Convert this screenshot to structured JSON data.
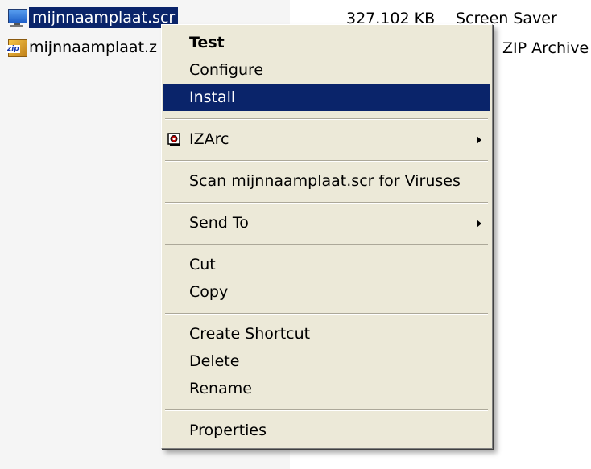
{
  "files": [
    {
      "name": "mijnnaamplaat.scr",
      "size": "327.102 KB",
      "type": "Screen Saver",
      "icon": "monitor-icon",
      "selected": true
    },
    {
      "name": "mijnnaamplaat.z",
      "type": "ZIP Archive",
      "icon": "zip-icon",
      "selected": false
    }
  ],
  "menu": {
    "items": [
      {
        "label": "Test",
        "bold": true
      },
      {
        "label": "Configure"
      },
      {
        "label": "Install",
        "highlighted": true
      },
      {
        "label": "IZArc",
        "icon": "izarc-icon",
        "submenu": true
      },
      {
        "label": "Scan mijnnaamplaat.scr for Viruses"
      },
      {
        "label": "Send To",
        "submenu": true
      },
      {
        "label": "Cut"
      },
      {
        "label": "Copy"
      },
      {
        "label": "Create Shortcut"
      },
      {
        "label": "Delete"
      },
      {
        "label": "Rename"
      },
      {
        "label": "Properties"
      }
    ]
  },
  "colors": {
    "selection": "#0a246a",
    "menu_bg": "#ece9d8",
    "icon_red": "#c00000"
  }
}
